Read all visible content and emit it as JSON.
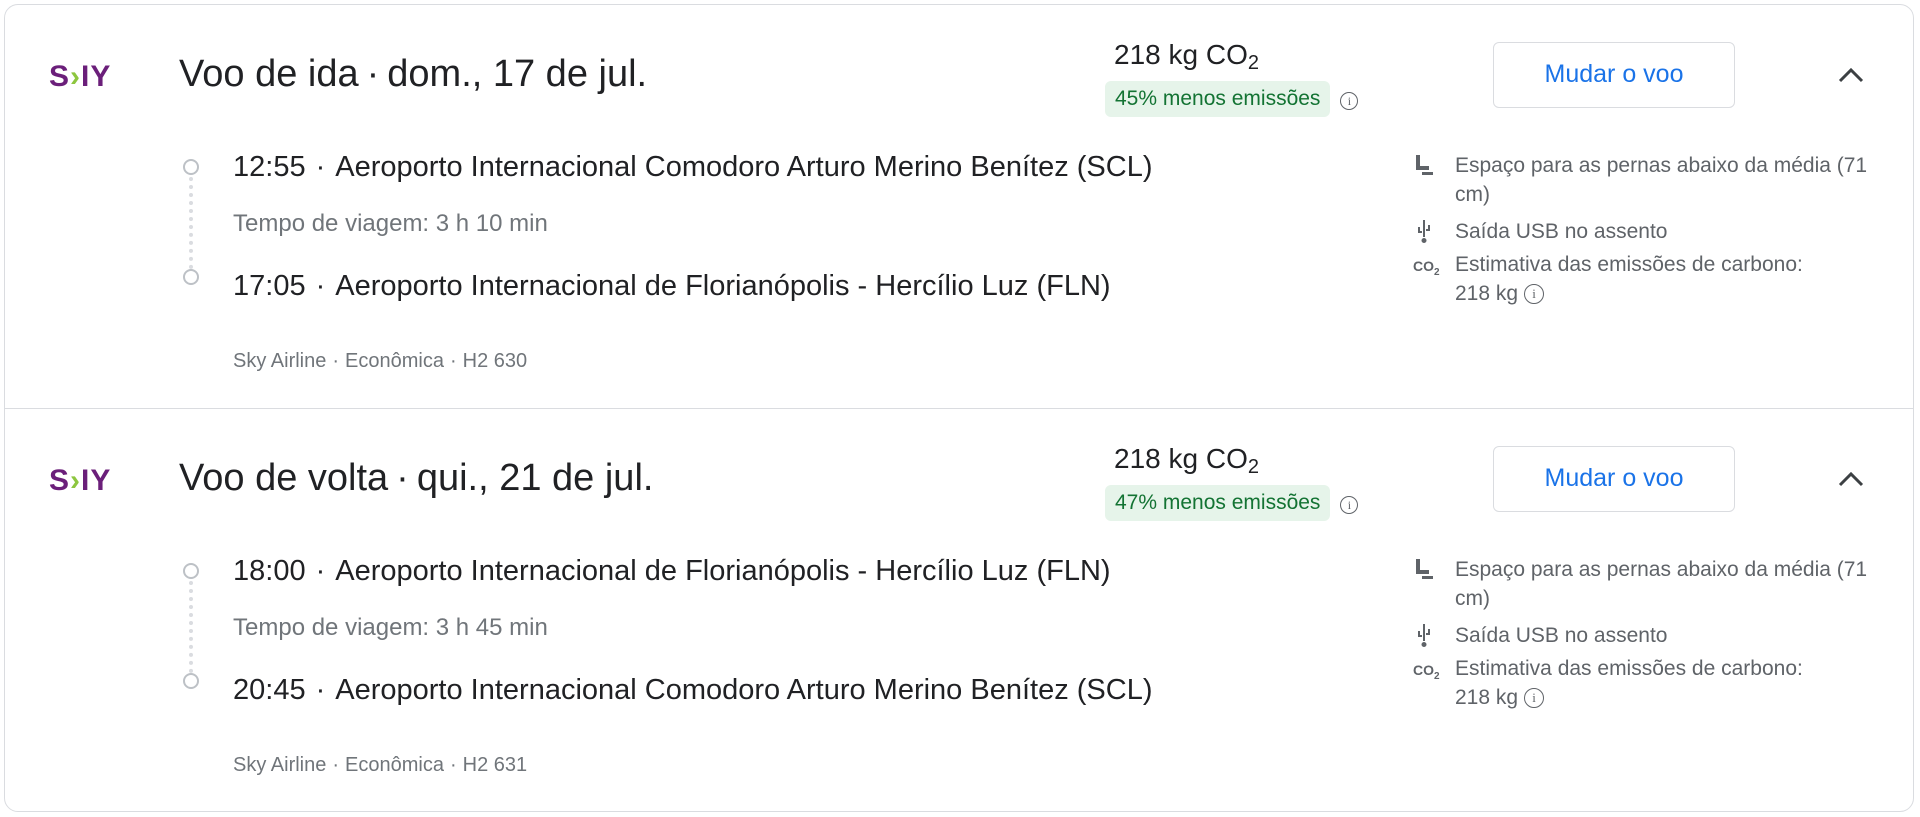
{
  "flights": [
    {
      "airline_logo": "SKY",
      "title": "Voo de ida",
      "date": "dom., 17 de jul.",
      "emissions": "218 kg CO",
      "emissions_sub": "2",
      "emissions_badge": "45% menos emissões",
      "change_label": "Mudar o voo",
      "depart_time": "12:55",
      "depart_airport": "Aeroporto Internacional Comodoro Arturo Merino Benítez (SCL)",
      "duration": "Tempo de viagem: 3 h 10 min",
      "arrive_time": "17:05",
      "arrive_airport": "Aeroporto Internacional de Florianópolis - Hercílio Luz (FLN)",
      "airline": "Sky Airline",
      "cabin": "Econômica",
      "flight_number": "H2 630",
      "amenities": {
        "legroom": "Espaço para as pernas abaixo da média (71 cm)",
        "usb": "Saída USB no assento",
        "carbon": "Estimativa das emissões de carbono:",
        "carbon_value": "218 kg"
      }
    },
    {
      "airline_logo": "SKY",
      "title": "Voo de volta",
      "date": "qui., 21 de jul.",
      "emissions": "218 kg CO",
      "emissions_sub": "2",
      "emissions_badge": "47% menos emissões",
      "change_label": "Mudar o voo",
      "depart_time": "18:00",
      "depart_airport": "Aeroporto Internacional de Florianópolis - Hercílio Luz (FLN)",
      "duration": "Tempo de viagem: 3 h 45 min",
      "arrive_time": "20:45",
      "arrive_airport": "Aeroporto Internacional Comodoro Arturo Merino Benítez (SCL)",
      "airline": "Sky Airline",
      "cabin": "Econômica",
      "flight_number": "H2 631",
      "amenities": {
        "legroom": "Espaço para as pernas abaixo da média (71 cm)",
        "usb": "Saída USB no assento",
        "carbon": "Estimativa das emissões de carbono:",
        "carbon_value": "218 kg"
      }
    }
  ],
  "colors": {
    "accent_blue": "#1a73e8",
    "badge_green_bg": "#e6f4ea",
    "badge_green_text": "#137333",
    "sky_purple": "#6b1f7a",
    "sky_green": "#8dc63f"
  },
  "icons": [
    "legroom-seat-icon",
    "usb-icon",
    "co2-icon",
    "info-icon",
    "chevron-up-icon"
  ]
}
